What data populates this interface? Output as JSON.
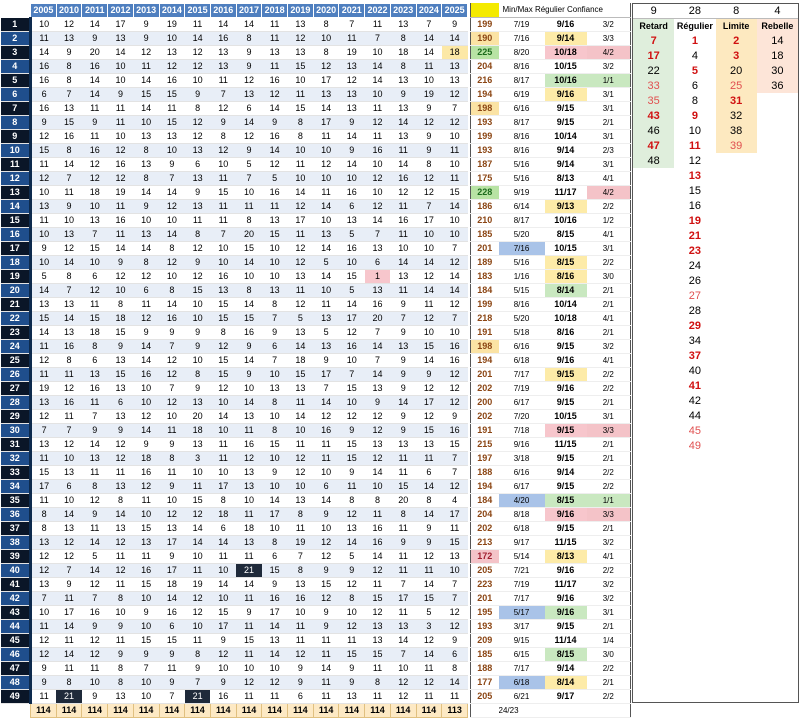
{
  "years": [
    "2005",
    "2010",
    "2011",
    "2012",
    "2013",
    "2014",
    "2015",
    "2016",
    "2017",
    "2018",
    "2019",
    "2020",
    "2021",
    "2022",
    "2023",
    "2024",
    "2025"
  ],
  "rows": [
    {
      "n": "1",
      "v": [
        "10",
        "12",
        "14",
        "17",
        "9",
        "19",
        "11",
        "14",
        "14",
        "11",
        "13",
        "8",
        "7",
        "11",
        "13",
        "7",
        "9"
      ],
      "total": "199",
      "date": "7/19",
      "range": "9/16",
      "conf": "3/2"
    },
    {
      "n": "2",
      "v": [
        "11",
        "13",
        "9",
        "13",
        "9",
        "10",
        "14",
        "16",
        "8",
        "11",
        "12",
        "10",
        "11",
        "7",
        "8",
        "14",
        "14"
      ],
      "total": "190",
      "date": "7/16",
      "range": "9/14",
      "conf": "3/3"
    },
    {
      "n": "3",
      "v": [
        "14",
        "9",
        "20",
        "14",
        "12",
        "13",
        "12",
        "13",
        "9",
        "13",
        "13",
        "8",
        "19",
        "10",
        "18",
        "14",
        "18"
      ],
      "total": "225",
      "date": "8/20",
      "range": "10/18",
      "conf": "4/2"
    },
    {
      "n": "4",
      "v": [
        "16",
        "8",
        "16",
        "10",
        "11",
        "12",
        "12",
        "13",
        "9",
        "11",
        "15",
        "12",
        "13",
        "14",
        "8",
        "11",
        "13"
      ],
      "total": "204",
      "date": "8/16",
      "range": "10/15",
      "conf": "3/2"
    },
    {
      "n": "5",
      "v": [
        "16",
        "8",
        "14",
        "10",
        "14",
        "16",
        "10",
        "11",
        "12",
        "16",
        "10",
        "17",
        "12",
        "14",
        "13",
        "10",
        "13"
      ],
      "total": "216",
      "date": "8/17",
      "range": "10/16",
      "conf": "1/1"
    },
    {
      "n": "6",
      "v": [
        "6",
        "7",
        "14",
        "9",
        "15",
        "15",
        "9",
        "7",
        "13",
        "12",
        "11",
        "13",
        "13",
        "10",
        "9",
        "19",
        "12"
      ],
      "total": "194",
      "date": "6/19",
      "range": "9/16",
      "conf": "3/1"
    },
    {
      "n": "7",
      "v": [
        "16",
        "13",
        "11",
        "11",
        "14",
        "11",
        "8",
        "12",
        "6",
        "14",
        "15",
        "14",
        "13",
        "11",
        "13",
        "9",
        "7"
      ],
      "total": "198",
      "date": "6/16",
      "range": "9/15",
      "conf": "3/1"
    },
    {
      "n": "8",
      "v": [
        "9",
        "15",
        "9",
        "11",
        "10",
        "15",
        "12",
        "9",
        "14",
        "9",
        "8",
        "17",
        "9",
        "12",
        "14",
        "12",
        "12"
      ],
      "total": "193",
      "date": "8/17",
      "range": "9/15",
      "conf": "2/1"
    },
    {
      "n": "9",
      "v": [
        "12",
        "16",
        "11",
        "10",
        "13",
        "13",
        "12",
        "8",
        "12",
        "16",
        "8",
        "11",
        "14",
        "11",
        "13",
        "9",
        "10"
      ],
      "total": "199",
      "date": "8/16",
      "range": "10/14",
      "conf": "3/1"
    },
    {
      "n": "10",
      "v": [
        "15",
        "8",
        "16",
        "12",
        "8",
        "10",
        "13",
        "12",
        "9",
        "14",
        "10",
        "10",
        "9",
        "16",
        "11",
        "9",
        "11"
      ],
      "total": "193",
      "date": "8/16",
      "range": "9/14",
      "conf": "2/3"
    },
    {
      "n": "11",
      "v": [
        "11",
        "14",
        "12",
        "16",
        "13",
        "9",
        "6",
        "10",
        "5",
        "12",
        "11",
        "12",
        "14",
        "10",
        "14",
        "8",
        "10"
      ],
      "total": "187",
      "date": "5/16",
      "range": "9/14",
      "conf": "3/1"
    },
    {
      "n": "12",
      "v": [
        "12",
        "7",
        "12",
        "12",
        "8",
        "7",
        "13",
        "11",
        "7",
        "5",
        "10",
        "10",
        "10",
        "12",
        "16",
        "12",
        "11"
      ],
      "total": "175",
      "date": "5/16",
      "range": "8/13",
      "conf": "4/1"
    },
    {
      "n": "13",
      "v": [
        "10",
        "11",
        "18",
        "19",
        "14",
        "14",
        "9",
        "15",
        "10",
        "16",
        "14",
        "11",
        "16",
        "10",
        "12",
        "12",
        "15"
      ],
      "total": "228",
      "date": "9/19",
      "range": "11/17",
      "conf": "4/2"
    },
    {
      "n": "14",
      "v": [
        "13",
        "9",
        "10",
        "11",
        "9",
        "12",
        "13",
        "11",
        "11",
        "11",
        "12",
        "14",
        "6",
        "12",
        "11",
        "7",
        "14"
      ],
      "total": "186",
      "date": "6/14",
      "range": "9/13",
      "conf": "2/2"
    },
    {
      "n": "15",
      "v": [
        "11",
        "10",
        "13",
        "16",
        "10",
        "10",
        "11",
        "11",
        "8",
        "13",
        "17",
        "10",
        "13",
        "14",
        "16",
        "17",
        "10"
      ],
      "total": "210",
      "date": "8/17",
      "range": "10/16",
      "conf": "1/2"
    },
    {
      "n": "16",
      "v": [
        "10",
        "13",
        "7",
        "11",
        "13",
        "14",
        "8",
        "7",
        "20",
        "15",
        "11",
        "13",
        "5",
        "7",
        "11",
        "10",
        "10"
      ],
      "total": "185",
      "date": "5/20",
      "range": "8/15",
      "conf": "4/1"
    },
    {
      "n": "17",
      "v": [
        "9",
        "12",
        "15",
        "14",
        "14",
        "8",
        "12",
        "10",
        "15",
        "10",
        "12",
        "14",
        "16",
        "13",
        "10",
        "10",
        "7"
      ],
      "total": "201",
      "date": "7/16",
      "range": "10/15",
      "conf": "3/1"
    },
    {
      "n": "18",
      "v": [
        "10",
        "14",
        "10",
        "9",
        "8",
        "12",
        "9",
        "10",
        "14",
        "10",
        "12",
        "5",
        "10",
        "6",
        "14",
        "14",
        "12"
      ],
      "total": "189",
      "date": "5/16",
      "range": "8/15",
      "conf": "2/2"
    },
    {
      "n": "19",
      "v": [
        "5",
        "8",
        "6",
        "12",
        "12",
        "10",
        "12",
        "16",
        "10",
        "10",
        "13",
        "14",
        "15",
        "1",
        "13",
        "12",
        "14"
      ],
      "total": "183",
      "date": "1/16",
      "range": "8/16",
      "conf": "3/0"
    },
    {
      "n": "20",
      "v": [
        "14",
        "7",
        "12",
        "10",
        "6",
        "8",
        "15",
        "13",
        "8",
        "13",
        "11",
        "10",
        "5",
        "13",
        "11",
        "14",
        "14"
      ],
      "total": "184",
      "date": "5/15",
      "range": "8/14",
      "conf": "2/1"
    },
    {
      "n": "21",
      "v": [
        "13",
        "13",
        "11",
        "8",
        "11",
        "14",
        "10",
        "15",
        "14",
        "8",
        "12",
        "11",
        "14",
        "16",
        "9",
        "11",
        "12"
      ],
      "total": "199",
      "date": "8/16",
      "range": "10/14",
      "conf": "2/1"
    },
    {
      "n": "22",
      "v": [
        "15",
        "14",
        "15",
        "18",
        "12",
        "16",
        "10",
        "15",
        "15",
        "7",
        "5",
        "13",
        "17",
        "20",
        "7",
        "12",
        "7"
      ],
      "total": "218",
      "date": "5/20",
      "range": "10/18",
      "conf": "4/1"
    },
    {
      "n": "23",
      "v": [
        "14",
        "13",
        "18",
        "15",
        "9",
        "9",
        "9",
        "8",
        "16",
        "9",
        "13",
        "5",
        "12",
        "7",
        "9",
        "10",
        "10"
      ],
      "total": "191",
      "date": "5/18",
      "range": "8/16",
      "conf": "2/1"
    },
    {
      "n": "24",
      "v": [
        "11",
        "16",
        "8",
        "9",
        "14",
        "7",
        "9",
        "12",
        "9",
        "6",
        "14",
        "13",
        "16",
        "14",
        "13",
        "15",
        "16"
      ],
      "total": "198",
      "date": "6/16",
      "range": "9/15",
      "conf": "3/2"
    },
    {
      "n": "25",
      "v": [
        "12",
        "8",
        "6",
        "13",
        "14",
        "12",
        "10",
        "15",
        "14",
        "7",
        "18",
        "9",
        "10",
        "7",
        "9",
        "14",
        "16"
      ],
      "total": "194",
      "date": "6/18",
      "range": "9/16",
      "conf": "4/1"
    },
    {
      "n": "26",
      "v": [
        "11",
        "11",
        "13",
        "15",
        "16",
        "12",
        "8",
        "15",
        "9",
        "10",
        "15",
        "17",
        "7",
        "14",
        "9",
        "9",
        "12"
      ],
      "total": "201",
      "date": "7/17",
      "range": "9/15",
      "conf": "2/2"
    },
    {
      "n": "27",
      "v": [
        "19",
        "12",
        "16",
        "13",
        "10",
        "7",
        "9",
        "12",
        "10",
        "13",
        "13",
        "7",
        "15",
        "13",
        "9",
        "12",
        "12"
      ],
      "total": "202",
      "date": "7/19",
      "range": "9/16",
      "conf": "2/2"
    },
    {
      "n": "28",
      "v": [
        "13",
        "16",
        "11",
        "6",
        "10",
        "12",
        "13",
        "10",
        "14",
        "8",
        "11",
        "14",
        "10",
        "9",
        "14",
        "17",
        "12"
      ],
      "total": "200",
      "date": "6/17",
      "range": "9/15",
      "conf": "2/1"
    },
    {
      "n": "29",
      "v": [
        "12",
        "11",
        "7",
        "13",
        "12",
        "10",
        "20",
        "14",
        "13",
        "10",
        "14",
        "12",
        "12",
        "12",
        "9",
        "12",
        "9"
      ],
      "total": "202",
      "date": "7/20",
      "range": "10/15",
      "conf": "3/1"
    },
    {
      "n": "30",
      "v": [
        "7",
        "7",
        "9",
        "9",
        "14",
        "11",
        "18",
        "10",
        "11",
        "8",
        "10",
        "16",
        "9",
        "12",
        "9",
        "15",
        "16"
      ],
      "total": "191",
      "date": "7/18",
      "range": "9/15",
      "conf": "3/3"
    },
    {
      "n": "31",
      "v": [
        "13",
        "12",
        "14",
        "12",
        "9",
        "9",
        "13",
        "11",
        "16",
        "15",
        "11",
        "11",
        "15",
        "13",
        "13",
        "13",
        "15"
      ],
      "total": "215",
      "date": "9/16",
      "range": "11/15",
      "conf": "2/1"
    },
    {
      "n": "32",
      "v": [
        "11",
        "10",
        "13",
        "12",
        "18",
        "8",
        "3",
        "11",
        "12",
        "10",
        "12",
        "11",
        "15",
        "12",
        "11",
        "11",
        "7"
      ],
      "total": "197",
      "date": "3/18",
      "range": "9/15",
      "conf": "2/1"
    },
    {
      "n": "33",
      "v": [
        "15",
        "13",
        "11",
        "11",
        "16",
        "11",
        "10",
        "10",
        "13",
        "9",
        "12",
        "10",
        "9",
        "14",
        "11",
        "6",
        "7"
      ],
      "total": "188",
      "date": "6/16",
      "range": "9/14",
      "conf": "2/2"
    },
    {
      "n": "34",
      "v": [
        "17",
        "6",
        "8",
        "13",
        "12",
        "9",
        "11",
        "17",
        "13",
        "10",
        "10",
        "6",
        "11",
        "10",
        "15",
        "14",
        "12"
      ],
      "total": "194",
      "date": "6/17",
      "range": "9/15",
      "conf": "2/2"
    },
    {
      "n": "35",
      "v": [
        "11",
        "10",
        "12",
        "8",
        "11",
        "10",
        "15",
        "8",
        "10",
        "14",
        "13",
        "14",
        "8",
        "8",
        "20",
        "8",
        "4"
      ],
      "total": "184",
      "date": "4/20",
      "range": "8/15",
      "conf": "1/1"
    },
    {
      "n": "36",
      "v": [
        "8",
        "14",
        "9",
        "14",
        "10",
        "12",
        "12",
        "18",
        "11",
        "17",
        "8",
        "9",
        "12",
        "11",
        "8",
        "14",
        "17"
      ],
      "total": "204",
      "date": "8/18",
      "range": "9/16",
      "conf": "3/3"
    },
    {
      "n": "37",
      "v": [
        "8",
        "13",
        "11",
        "13",
        "15",
        "13",
        "14",
        "6",
        "18",
        "10",
        "11",
        "10",
        "13",
        "16",
        "11",
        "9",
        "11"
      ],
      "total": "202",
      "date": "6/18",
      "range": "9/15",
      "conf": "2/1"
    },
    {
      "n": "38",
      "v": [
        "13",
        "12",
        "14",
        "12",
        "13",
        "17",
        "14",
        "14",
        "13",
        "8",
        "19",
        "12",
        "14",
        "16",
        "9",
        "9",
        "15"
      ],
      "total": "213",
      "date": "9/17",
      "range": "11/15",
      "conf": "3/2"
    },
    {
      "n": "39",
      "v": [
        "12",
        "12",
        "5",
        "11",
        "11",
        "9",
        "10",
        "11",
        "11",
        "6",
        "7",
        "12",
        "5",
        "14",
        "11",
        "12",
        "13"
      ],
      "total": "172",
      "date": "5/14",
      "range": "8/13",
      "conf": "4/1"
    },
    {
      "n": "40",
      "v": [
        "12",
        "7",
        "14",
        "12",
        "16",
        "17",
        "11",
        "10",
        "21",
        "15",
        "8",
        "9",
        "9",
        "12",
        "11",
        "11",
        "10"
      ],
      "total": "205",
      "date": "7/21",
      "range": "9/16",
      "conf": "2/2"
    },
    {
      "n": "41",
      "v": [
        "13",
        "9",
        "12",
        "11",
        "15",
        "18",
        "19",
        "14",
        "14",
        "9",
        "13",
        "15",
        "12",
        "11",
        "7",
        "14",
        "7"
      ],
      "total": "223",
      "date": "7/19",
      "range": "11/17",
      "conf": "3/2"
    },
    {
      "n": "42",
      "v": [
        "7",
        "11",
        "7",
        "8",
        "10",
        "14",
        "12",
        "10",
        "11",
        "16",
        "16",
        "12",
        "8",
        "15",
        "17",
        "15",
        "7"
      ],
      "total": "201",
      "date": "7/17",
      "range": "9/16",
      "conf": "3/2"
    },
    {
      "n": "43",
      "v": [
        "10",
        "17",
        "16",
        "10",
        "9",
        "16",
        "12",
        "15",
        "9",
        "17",
        "10",
        "9",
        "10",
        "12",
        "11",
        "5",
        "12"
      ],
      "total": "195",
      "date": "5/17",
      "range": "9/16",
      "conf": "3/1"
    },
    {
      "n": "44",
      "v": [
        "11",
        "14",
        "9",
        "9",
        "10",
        "6",
        "10",
        "17",
        "11",
        "14",
        "11",
        "9",
        "12",
        "13",
        "13",
        "3",
        "12"
      ],
      "total": "193",
      "date": "3/17",
      "range": "9/15",
      "conf": "2/1"
    },
    {
      "n": "45",
      "v": [
        "12",
        "11",
        "12",
        "11",
        "15",
        "15",
        "11",
        "9",
        "15",
        "13",
        "11",
        "11",
        "11",
        "13",
        "14",
        "12",
        "9"
      ],
      "total": "209",
      "date": "9/15",
      "range": "11/14",
      "conf": "1/4"
    },
    {
      "n": "46",
      "v": [
        "12",
        "14",
        "12",
        "9",
        "9",
        "9",
        "8",
        "12",
        "11",
        "14",
        "12",
        "11",
        "15",
        "15",
        "7",
        "14",
        "6"
      ],
      "total": "185",
      "date": "6/15",
      "range": "8/15",
      "conf": "3/0"
    },
    {
      "n": "47",
      "v": [
        "9",
        "11",
        "11",
        "8",
        "7",
        "11",
        "9",
        "10",
        "10",
        "10",
        "9",
        "14",
        "9",
        "11",
        "10",
        "11",
        "8"
      ],
      "total": "188",
      "date": "7/17",
      "range": "9/14",
      "conf": "2/2"
    },
    {
      "n": "48",
      "v": [
        "9",
        "8",
        "10",
        "8",
        "10",
        "9",
        "7",
        "9",
        "12",
        "12",
        "9",
        "11",
        "9",
        "8",
        "12",
        "12",
        "14"
      ],
      "total": "177",
      "date": "6/18",
      "range": "8/14",
      "conf": "2/1"
    },
    {
      "n": "49",
      "v": [
        "11",
        "21",
        "9",
        "13",
        "10",
        "7",
        "21",
        "16",
        "11",
        "11",
        "6",
        "11",
        "13",
        "11",
        "12",
        "11",
        "11"
      ],
      "total": "205",
      "date": "6/21",
      "range": "9/17",
      "conf": "2/2"
    }
  ],
  "footer_totals": [
    "114",
    "114",
    "114",
    "114",
    "114",
    "114",
    "114",
    "114",
    "114",
    "114",
    "114",
    "114",
    "114",
    "114",
    "114",
    "114",
    "113"
  ],
  "footer_ratio": "24/23",
  "side_header": "Min/Max Régulier Confiance",
  "categories": {
    "counts": [
      "9",
      "28",
      "8",
      "4"
    ],
    "headers": [
      "Retard",
      "Régulier",
      "Limite",
      "Rebelle"
    ],
    "retard": [
      "7",
      "17",
      "22",
      "33",
      "35",
      "43",
      "46",
      "47",
      "48"
    ],
    "regulier": [
      "1",
      "4",
      "5",
      "6",
      "8",
      "9",
      "10",
      "11",
      "12",
      "13",
      "15",
      "16",
      "19",
      "21",
      "23",
      "24",
      "26",
      "27",
      "28",
      "29",
      "34",
      "37",
      "40",
      "41",
      "42",
      "44",
      "45",
      "49"
    ],
    "limite": [
      "2",
      "3",
      "20",
      "25",
      "31",
      "32",
      "38",
      "39"
    ],
    "rebelle": [
      "14",
      "18",
      "30",
      "36"
    ]
  },
  "colors": {
    "header_blue": "#4f7fbf",
    "index_dark": "#0a1628",
    "index_blue": "#1f4e8c",
    "total_brown": "#8b4513"
  }
}
